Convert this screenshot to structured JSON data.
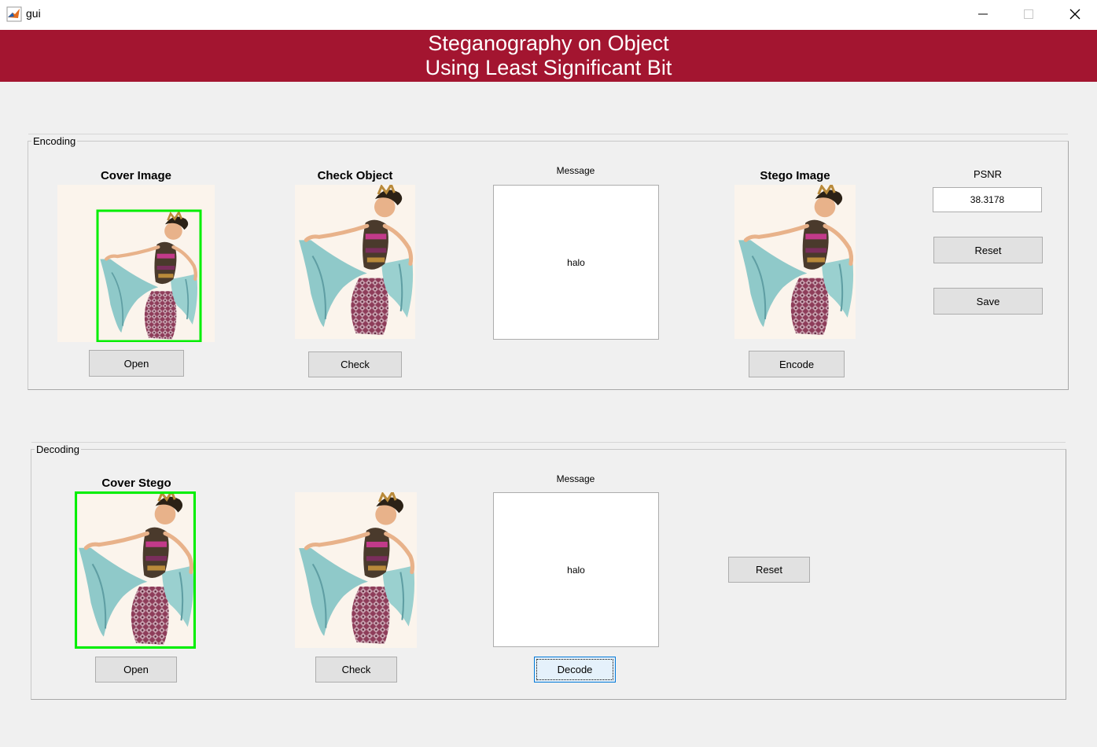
{
  "window": {
    "title": "gui",
    "app_icon": "matlab-icon"
  },
  "banner": {
    "line1": "Steganography on Object",
    "line2": "Using Least Significant Bit",
    "color": "#a31530"
  },
  "encoding": {
    "title": "Encoding",
    "cover_image_label": "Cover Image",
    "check_object_label": "Check Object",
    "message_label": "Message",
    "message_value": "halo",
    "stego_image_label": "Stego Image",
    "psnr_label": "PSNR",
    "psnr_value": "38.3178",
    "open_label": "Open",
    "check_label": "Check",
    "encode_label": "Encode",
    "reset_label": "Reset",
    "save_label": "Save"
  },
  "decoding": {
    "title": "Decoding",
    "cover_stego_label": "Cover Stego",
    "message_label": "Message",
    "message_value": "halo",
    "open_label": "Open",
    "check_label": "Check",
    "decode_label": "Decode",
    "reset_label": "Reset"
  },
  "colors": {
    "detection_box": "#00ee00"
  }
}
